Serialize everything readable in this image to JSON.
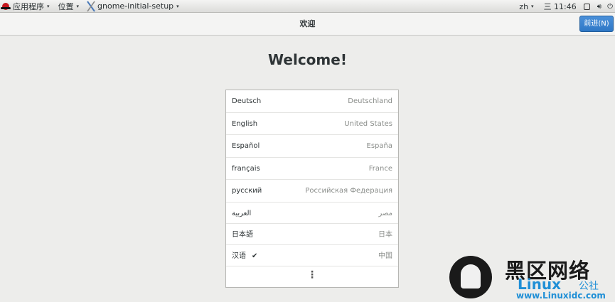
{
  "topbar": {
    "apps_label": "应用程序",
    "places_label": "位置",
    "app_label": "gnome-initial-setup",
    "lang_indicator": "zh",
    "clock": "三 11:46",
    "caret": "▾"
  },
  "header": {
    "title": "欢迎",
    "next_label": "前进(N)"
  },
  "main": {
    "heading": "Welcome!",
    "languages": [
      {
        "name": "Deutsch",
        "region": "Deutschland",
        "selected": false
      },
      {
        "name": "English",
        "region": "United States",
        "selected": false
      },
      {
        "name": "Español",
        "region": "España",
        "selected": false
      },
      {
        "name": "français",
        "region": "France",
        "selected": false
      },
      {
        "name": "русский",
        "region": "Российская Федерация",
        "selected": false
      },
      {
        "name": "العربية",
        "region": "مصر",
        "selected": false
      },
      {
        "name": "日本語",
        "region": "日本",
        "selected": false
      },
      {
        "name": "汉语",
        "region": "中国",
        "selected": true
      }
    ],
    "more_label": "⋮",
    "check_glyph": "✔"
  },
  "watermark": {
    "cn_text": "黑区网络",
    "linux_text": "Linux",
    "club_text": "公社",
    "site_text": "www.Linuxidc.com"
  },
  "icons": {
    "accent": "#2f78c6"
  }
}
